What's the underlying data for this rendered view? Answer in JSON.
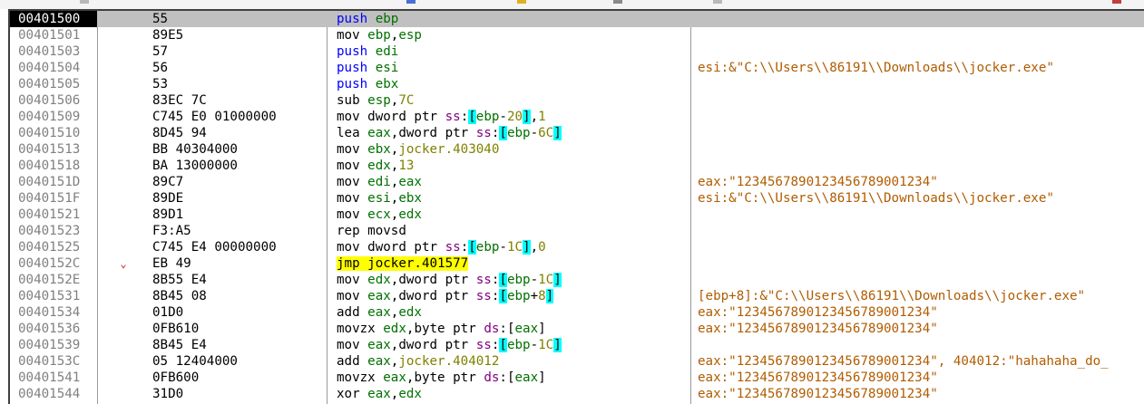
{
  "colors": {
    "background": "#ffffff",
    "selected_row": "#c0c0c0",
    "address": "#808080",
    "push": "#0000ff",
    "register": "#007000",
    "segment": "#800080",
    "number": "#808000",
    "comment": "#b05c00",
    "bracket_highlight": "#00ffff",
    "jump_highlight": "#ffff00",
    "branch_arrow": "#d01818"
  },
  "disassembly": {
    "rows": [
      {
        "addr": "00401500",
        "bytes": "55",
        "arrow": "",
        "selected": true,
        "jump": false,
        "instr": [
          {
            "t": "push",
            "c": "kw-push"
          },
          {
            "t": " "
          },
          {
            "t": "ebp",
            "c": "reg"
          }
        ],
        "comment": ""
      },
      {
        "addr": "00401501",
        "bytes": "89E5",
        "arrow": "",
        "jump": false,
        "instr": [
          {
            "t": "mov",
            "c": "kw"
          },
          {
            "t": " "
          },
          {
            "t": "ebp",
            "c": "reg"
          },
          {
            "t": ","
          },
          {
            "t": "esp",
            "c": "reg"
          }
        ],
        "comment": ""
      },
      {
        "addr": "00401503",
        "bytes": "57",
        "arrow": "",
        "jump": false,
        "instr": [
          {
            "t": "push",
            "c": "kw-push"
          },
          {
            "t": " "
          },
          {
            "t": "edi",
            "c": "reg"
          }
        ],
        "comment": ""
      },
      {
        "addr": "00401504",
        "bytes": "56",
        "arrow": "",
        "jump": false,
        "instr": [
          {
            "t": "push",
            "c": "kw-push"
          },
          {
            "t": " "
          },
          {
            "t": "esi",
            "c": "reg"
          }
        ],
        "comment": "esi:&\"C:\\\\Users\\\\86191\\\\Downloads\\\\jocker.exe\""
      },
      {
        "addr": "00401505",
        "bytes": "53",
        "arrow": "",
        "jump": false,
        "instr": [
          {
            "t": "push",
            "c": "kw-push"
          },
          {
            "t": " "
          },
          {
            "t": "ebx",
            "c": "reg"
          }
        ],
        "comment": ""
      },
      {
        "addr": "00401506",
        "bytes": "83EC 7C",
        "arrow": "",
        "jump": false,
        "instr": [
          {
            "t": "sub",
            "c": "kw"
          },
          {
            "t": " "
          },
          {
            "t": "esp",
            "c": "reg"
          },
          {
            "t": ","
          },
          {
            "t": "7C",
            "c": "num"
          }
        ],
        "comment": ""
      },
      {
        "addr": "00401509",
        "bytes": "C745 E0 01000000",
        "arrow": "",
        "jump": false,
        "instr": [
          {
            "t": "mov",
            "c": "kw"
          },
          {
            "t": " "
          },
          {
            "t": "dword ptr",
            "c": "kw"
          },
          {
            "t": " "
          },
          {
            "t": "ss",
            "c": "seg"
          },
          {
            "t": ":"
          },
          {
            "t": "[",
            "c": "br"
          },
          {
            "t": "ebp",
            "c": "reg"
          },
          {
            "t": "-"
          },
          {
            "t": "20",
            "c": "num"
          },
          {
            "t": "]",
            "c": "br"
          },
          {
            "t": ","
          },
          {
            "t": "1",
            "c": "num"
          }
        ],
        "comment": ""
      },
      {
        "addr": "00401510",
        "bytes": "8D45 94",
        "arrow": "",
        "jump": false,
        "instr": [
          {
            "t": "lea",
            "c": "kw"
          },
          {
            "t": " "
          },
          {
            "t": "eax",
            "c": "reg"
          },
          {
            "t": ","
          },
          {
            "t": "dword ptr",
            "c": "kw"
          },
          {
            "t": " "
          },
          {
            "t": "ss",
            "c": "seg"
          },
          {
            "t": ":"
          },
          {
            "t": "[",
            "c": "br"
          },
          {
            "t": "ebp",
            "c": "reg"
          },
          {
            "t": "-"
          },
          {
            "t": "6C",
            "c": "num"
          },
          {
            "t": "]",
            "c": "br"
          }
        ],
        "comment": ""
      },
      {
        "addr": "00401513",
        "bytes": "BB 40304000",
        "arrow": "",
        "jump": false,
        "instr": [
          {
            "t": "mov",
            "c": "kw"
          },
          {
            "t": " "
          },
          {
            "t": "ebx",
            "c": "reg"
          },
          {
            "t": ","
          },
          {
            "t": "jocker.403040",
            "c": "lab"
          }
        ],
        "comment": ""
      },
      {
        "addr": "00401518",
        "bytes": "BA 13000000",
        "arrow": "",
        "jump": false,
        "instr": [
          {
            "t": "mov",
            "c": "kw"
          },
          {
            "t": " "
          },
          {
            "t": "edx",
            "c": "reg"
          },
          {
            "t": ","
          },
          {
            "t": "13",
            "c": "num"
          }
        ],
        "comment": ""
      },
      {
        "addr": "0040151D",
        "bytes": "89C7",
        "arrow": "",
        "jump": false,
        "instr": [
          {
            "t": "mov",
            "c": "kw"
          },
          {
            "t": " "
          },
          {
            "t": "edi",
            "c": "reg"
          },
          {
            "t": ","
          },
          {
            "t": "eax",
            "c": "reg"
          }
        ],
        "comment": "eax:\"1234567890123456789001234\""
      },
      {
        "addr": "0040151F",
        "bytes": "89DE",
        "arrow": "",
        "jump": false,
        "instr": [
          {
            "t": "mov",
            "c": "kw"
          },
          {
            "t": " "
          },
          {
            "t": "esi",
            "c": "reg"
          },
          {
            "t": ","
          },
          {
            "t": "ebx",
            "c": "reg"
          }
        ],
        "comment": "esi:&\"C:\\\\Users\\\\86191\\\\Downloads\\\\jocker.exe\""
      },
      {
        "addr": "00401521",
        "bytes": "89D1",
        "arrow": "",
        "jump": false,
        "instr": [
          {
            "t": "mov",
            "c": "kw"
          },
          {
            "t": " "
          },
          {
            "t": "ecx",
            "c": "reg"
          },
          {
            "t": ","
          },
          {
            "t": "edx",
            "c": "reg"
          }
        ],
        "comment": ""
      },
      {
        "addr": "00401523",
        "bytes": "F3:A5",
        "arrow": "",
        "jump": false,
        "instr": [
          {
            "t": "rep movsd",
            "c": "kw"
          }
        ],
        "comment": ""
      },
      {
        "addr": "00401525",
        "bytes": "C745 E4 00000000",
        "arrow": "",
        "jump": false,
        "instr": [
          {
            "t": "mov",
            "c": "kw"
          },
          {
            "t": " "
          },
          {
            "t": "dword ptr",
            "c": "kw"
          },
          {
            "t": " "
          },
          {
            "t": "ss",
            "c": "seg"
          },
          {
            "t": ":"
          },
          {
            "t": "[",
            "c": "br"
          },
          {
            "t": "ebp",
            "c": "reg"
          },
          {
            "t": "-"
          },
          {
            "t": "1C",
            "c": "num"
          },
          {
            "t": "]",
            "c": "br"
          },
          {
            "t": ","
          },
          {
            "t": "0",
            "c": "num"
          }
        ],
        "comment": ""
      },
      {
        "addr": "0040152C",
        "bytes": "EB 49",
        "arrow": "⌄",
        "jump": true,
        "instr": [
          {
            "t": "jmp",
            "c": "kw"
          },
          {
            "t": " "
          },
          {
            "t": "jocker.401577",
            "c": "lab"
          }
        ],
        "comment": ""
      },
      {
        "addr": "0040152E",
        "bytes": "8B55 E4",
        "arrow": "",
        "jump": false,
        "instr": [
          {
            "t": "mov",
            "c": "kw"
          },
          {
            "t": " "
          },
          {
            "t": "edx",
            "c": "reg"
          },
          {
            "t": ","
          },
          {
            "t": "dword ptr",
            "c": "kw"
          },
          {
            "t": " "
          },
          {
            "t": "ss",
            "c": "seg"
          },
          {
            "t": ":"
          },
          {
            "t": "[",
            "c": "br"
          },
          {
            "t": "ebp",
            "c": "reg"
          },
          {
            "t": "-"
          },
          {
            "t": "1C",
            "c": "num"
          },
          {
            "t": "]",
            "c": "br"
          }
        ],
        "comment": ""
      },
      {
        "addr": "00401531",
        "bytes": "8B45 08",
        "arrow": "",
        "jump": false,
        "instr": [
          {
            "t": "mov",
            "c": "kw"
          },
          {
            "t": " "
          },
          {
            "t": "eax",
            "c": "reg"
          },
          {
            "t": ","
          },
          {
            "t": "dword ptr",
            "c": "kw"
          },
          {
            "t": " "
          },
          {
            "t": "ss",
            "c": "seg"
          },
          {
            "t": ":"
          },
          {
            "t": "[",
            "c": "br"
          },
          {
            "t": "ebp",
            "c": "reg"
          },
          {
            "t": "+"
          },
          {
            "t": "8",
            "c": "num"
          },
          {
            "t": "]",
            "c": "br"
          }
        ],
        "comment": "[ebp+8]:&\"C:\\\\Users\\\\86191\\\\Downloads\\\\jocker.exe\""
      },
      {
        "addr": "00401534",
        "bytes": "01D0",
        "arrow": "",
        "jump": false,
        "instr": [
          {
            "t": "add",
            "c": "kw"
          },
          {
            "t": " "
          },
          {
            "t": "eax",
            "c": "reg"
          },
          {
            "t": ","
          },
          {
            "t": "edx",
            "c": "reg"
          }
        ],
        "comment": "eax:\"1234567890123456789001234\""
      },
      {
        "addr": "00401536",
        "bytes": "0FB610",
        "arrow": "",
        "jump": false,
        "instr": [
          {
            "t": "movzx",
            "c": "kw"
          },
          {
            "t": " "
          },
          {
            "t": "edx",
            "c": "reg"
          },
          {
            "t": ","
          },
          {
            "t": "byte ptr",
            "c": "kw"
          },
          {
            "t": " "
          },
          {
            "t": "ds",
            "c": "seg"
          },
          {
            "t": ":["
          },
          {
            "t": "eax",
            "c": "reg"
          },
          {
            "t": "]"
          }
        ],
        "comment": "eax:\"1234567890123456789001234\""
      },
      {
        "addr": "00401539",
        "bytes": "8B45 E4",
        "arrow": "",
        "jump": false,
        "instr": [
          {
            "t": "mov",
            "c": "kw"
          },
          {
            "t": " "
          },
          {
            "t": "eax",
            "c": "reg"
          },
          {
            "t": ","
          },
          {
            "t": "dword ptr",
            "c": "kw"
          },
          {
            "t": " "
          },
          {
            "t": "ss",
            "c": "seg"
          },
          {
            "t": ":"
          },
          {
            "t": "[",
            "c": "br"
          },
          {
            "t": "ebp",
            "c": "reg"
          },
          {
            "t": "-"
          },
          {
            "t": "1C",
            "c": "num"
          },
          {
            "t": "]",
            "c": "br"
          }
        ],
        "comment": ""
      },
      {
        "addr": "0040153C",
        "bytes": "05 12404000",
        "arrow": "",
        "jump": false,
        "instr": [
          {
            "t": "add",
            "c": "kw"
          },
          {
            "t": " "
          },
          {
            "t": "eax",
            "c": "reg"
          },
          {
            "t": ","
          },
          {
            "t": "jocker.404012",
            "c": "lab"
          }
        ],
        "comment": "eax:\"1234567890123456789001234\", 404012:\"hahahaha_do_"
      },
      {
        "addr": "00401541",
        "bytes": "0FB600",
        "arrow": "",
        "jump": false,
        "instr": [
          {
            "t": "movzx",
            "c": "kw"
          },
          {
            "t": " "
          },
          {
            "t": "eax",
            "c": "reg"
          },
          {
            "t": ","
          },
          {
            "t": "byte ptr",
            "c": "kw"
          },
          {
            "t": " "
          },
          {
            "t": "ds",
            "c": "seg"
          },
          {
            "t": ":["
          },
          {
            "t": "eax",
            "c": "reg"
          },
          {
            "t": "]"
          }
        ],
        "comment": "eax:\"1234567890123456789001234\""
      },
      {
        "addr": "00401544",
        "bytes": "31D0",
        "arrow": "",
        "jump": false,
        "instr": [
          {
            "t": "xor",
            "c": "kw"
          },
          {
            "t": " "
          },
          {
            "t": "eax",
            "c": "reg"
          },
          {
            "t": ","
          },
          {
            "t": "edx",
            "c": "reg"
          }
        ],
        "comment": "eax:\"1234567890123456789001234\""
      }
    ]
  }
}
